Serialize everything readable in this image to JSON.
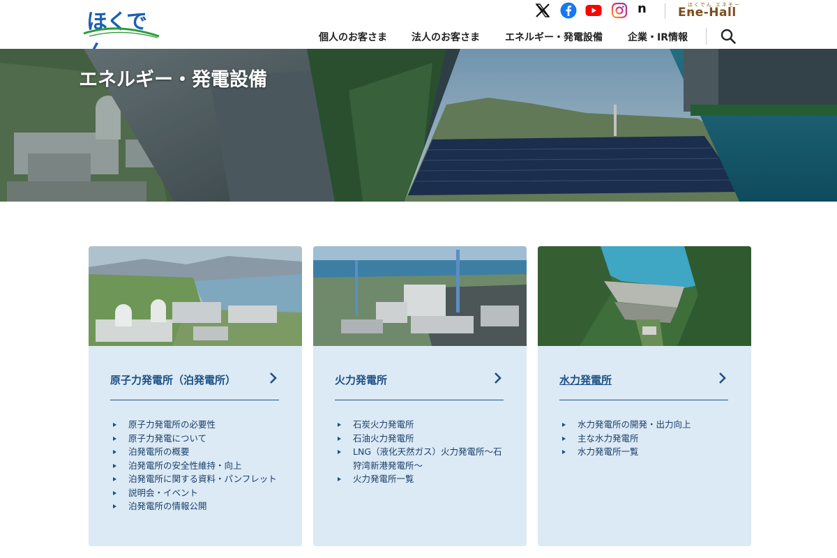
{
  "header": {
    "logo_text": "ほくでん",
    "social_icons": [
      "x-icon",
      "facebook-icon",
      "youtube-icon",
      "instagram-icon",
      "note-icon"
    ],
    "note_label": "n",
    "enehall_small": "ほくでん エネモール",
    "enehall_label": "Ene-Hall",
    "nav": [
      "個人のお客さま",
      "法人のお客さま",
      "エネルギー・発電設備",
      "企業・IR情報"
    ]
  },
  "hero": {
    "title": "エネルギー・発電設備"
  },
  "cards": [
    {
      "title": "原子力発電所（泊発電所）",
      "items": [
        "原子力発電所の必要性",
        "原子力発電について",
        "泊発電所の概要",
        "泊発電所の安全性維持・向上",
        "泊発電所に関する資料・パンフレット",
        "説明会・イベント",
        "泊発電所の情報公開"
      ]
    },
    {
      "title": "火力発電所",
      "items": [
        "石炭火力発電所",
        "石油火力発電所",
        "LNG（液化天然ガス）火力発電所〜石狩湾新港発電所〜",
        "火力発電所一覧"
      ]
    },
    {
      "title": "水力発電所",
      "items": [
        "水力発電所の開発・出力向上",
        "主な水力発電所",
        "水力発電所一覧"
      ]
    }
  ],
  "colors": {
    "brand_blue": "#1a5fb4",
    "brand_green": "#2e9b3a",
    "card_bg": "#dceaf5",
    "card_text": "#1c4f86"
  }
}
